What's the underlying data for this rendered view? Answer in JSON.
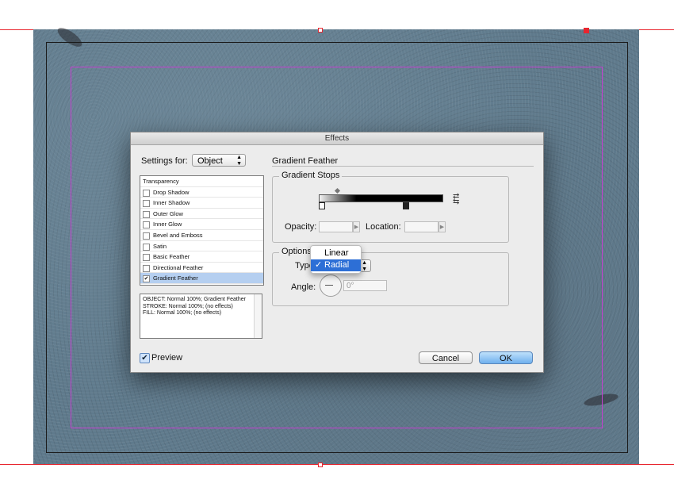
{
  "dialog": {
    "title": "Effects",
    "settings_for_label": "Settings for:",
    "settings_for_value": "Object",
    "section_title": "Gradient Feather",
    "effects_list": [
      {
        "label": "Transparency",
        "checked": false,
        "header": true
      },
      {
        "label": "Drop Shadow",
        "checked": false
      },
      {
        "label": "Inner Shadow",
        "checked": false
      },
      {
        "label": "Outer Glow",
        "checked": false
      },
      {
        "label": "Inner Glow",
        "checked": false
      },
      {
        "label": "Bevel and Emboss",
        "checked": false
      },
      {
        "label": "Satin",
        "checked": false
      },
      {
        "label": "Basic Feather",
        "checked": false
      },
      {
        "label": "Directional Feather",
        "checked": false
      },
      {
        "label": "Gradient Feather",
        "checked": true,
        "selected": true
      }
    ],
    "summary_lines": [
      "OBJECT: Normal 100%; Gradient Feather",
      "STROKE: Normal 100%; (no effects)",
      "FILL: Normal 100%; (no effects)"
    ],
    "gradient_stops": {
      "group_title": "Gradient Stops",
      "opacity_label": "Opacity:",
      "opacity_value": "",
      "location_label": "Location:",
      "location_value": ""
    },
    "options": {
      "group_title": "Options",
      "type_label": "Type",
      "type_value": "Radial",
      "type_menu": [
        "Linear",
        "Radial"
      ],
      "angle_label": "Angle:",
      "angle_value": "0°"
    },
    "preview_label": "Preview",
    "preview_checked": true,
    "cancel_label": "Cancel",
    "ok_label": "OK"
  },
  "icons": {
    "swap_icon": "reverse-gradient-icon",
    "check_mark": "✓",
    "checkbox_mark": "✔"
  },
  "colors": {
    "bleed": "#e8262f",
    "margin_guide": "#c43fd0",
    "selection": "#b5cff0",
    "ok_button": "#6fb0ee",
    "menu_highlight": "#2d6fd6"
  }
}
